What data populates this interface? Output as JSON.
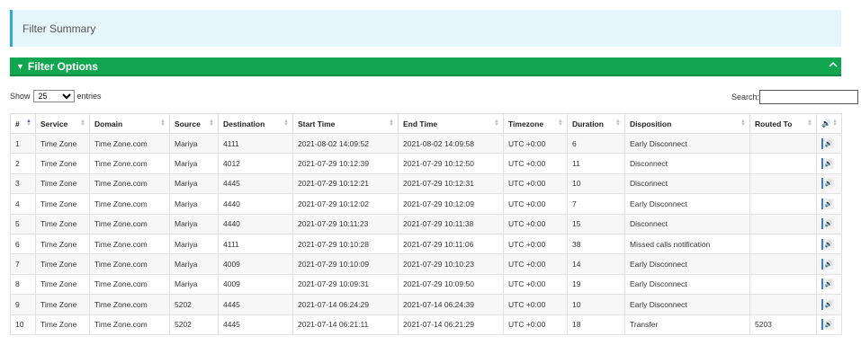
{
  "summary": {
    "title": "Filter Summary"
  },
  "filter_options": {
    "label": "Filter Options"
  },
  "length_control": {
    "show_label": "Show",
    "selected": "25",
    "entries_label": "entries"
  },
  "search": {
    "label": "Search:",
    "value": ""
  },
  "table": {
    "headers": [
      "#",
      "Service",
      "Domain",
      "Source",
      "Destination",
      "Start Time",
      "End Time",
      "Timezone",
      "Duration",
      "Disposition",
      "Routed To",
      "🔊"
    ],
    "rows": [
      [
        "1",
        "Time Zone",
        "Time Zone.com",
        "Mariya",
        "4111",
        "2021-08-02 14:09:52",
        "2021-08-02 14:09:58",
        "UTC +0:00",
        "6",
        "Early Disconnect",
        ""
      ],
      [
        "2",
        "Time Zone",
        "Time Zone.com",
        "Mariya",
        "4012",
        "2021-07-29 10:12:39",
        "2021-07-29 10:12:50",
        "UTC +0:00",
        "11",
        "Disconnect",
        ""
      ],
      [
        "3",
        "Time Zone",
        "Time Zone.com",
        "Mariya",
        "4445",
        "2021-07-29 10:12:21",
        "2021-07-29 10:12:31",
        "UTC +0:00",
        "10",
        "Disconnect",
        ""
      ],
      [
        "4",
        "Time Zone",
        "Time Zone.com",
        "Mariya",
        "4440",
        "2021-07-29 10:12:02",
        "2021-07-29 10:12:09",
        "UTC +0:00",
        "7",
        "Early Disconnect",
        ""
      ],
      [
        "5",
        "Time Zone",
        "Time Zone.com",
        "Mariya",
        "4440",
        "2021-07-29 10:11:23",
        "2021-07-29 10:11:38",
        "UTC +0:00",
        "15",
        "Disconnect",
        ""
      ],
      [
        "6",
        "Time Zone",
        "Time Zone.com",
        "Mariya",
        "4111",
        "2021-07-29 10:10:28",
        "2021-07-29 10:11:06",
        "UTC +0:00",
        "38",
        "Missed calls notification",
        ""
      ],
      [
        "7",
        "Time Zone",
        "Time Zone.com",
        "Mariya",
        "4009",
        "2021-07-29 10:10:09",
        "2021-07-29 10:10:23",
        "UTC +0:00",
        "14",
        "Early Disconnect",
        ""
      ],
      [
        "8",
        "Time Zone",
        "Time Zone.com",
        "Mariya",
        "4009",
        "2021-07-29 10:09:31",
        "2021-07-29 10:09:50",
        "UTC +0:00",
        "19",
        "Early Disconnect",
        ""
      ],
      [
        "9",
        "Time Zone",
        "Time Zone.com",
        "5202",
        "4445",
        "2021-07-14 06:24:29",
        "2021-07-14 06:24:39",
        "UTC +0:00",
        "10",
        "Early Disconnect",
        ""
      ],
      [
        "10",
        "Time Zone",
        "Time Zone.com",
        "5202",
        "4445",
        "2021-07-14 06:21:11",
        "2021-07-14 06:21:29",
        "UTC +0:00",
        "18",
        "Transfer",
        "5203"
      ]
    ],
    "play_icon": "🔊"
  },
  "colors": {
    "accent_green": "#12a650",
    "info_bg": "#e4f5fb",
    "info_border": "#2ea9d9",
    "sort_active": "#3a6fc4"
  },
  "icons": {
    "filter": "funnel-icon",
    "collapse": "chevron-up-icon",
    "audio": "speaker-icon",
    "sort": "sort-icon"
  }
}
